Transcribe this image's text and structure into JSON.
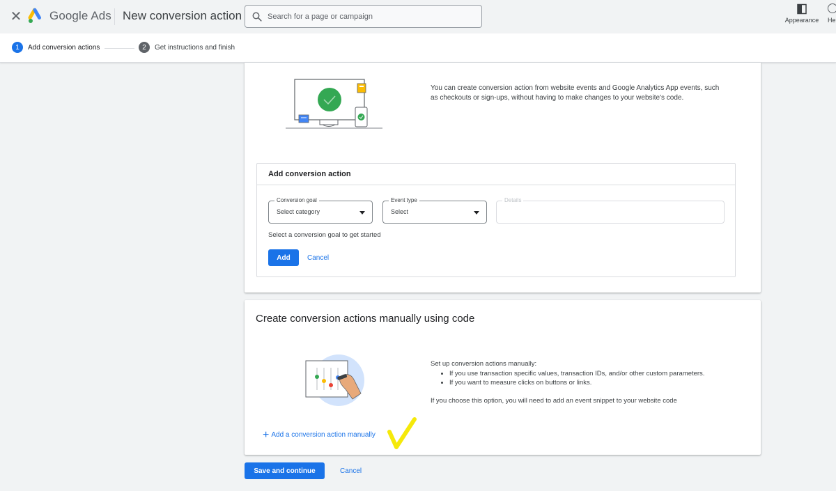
{
  "header": {
    "brand_google": "Google",
    "brand_ads": "Ads",
    "page_title": "New conversion action",
    "search_placeholder": "Search for a page or campaign",
    "appearance_label": "Appearance",
    "help_label": "He"
  },
  "stepper": {
    "steps": [
      {
        "number": "1",
        "label": "Add conversion actions"
      },
      {
        "number": "2",
        "label": "Get instructions and finish"
      }
    ]
  },
  "events_card": {
    "description": "You can create conversion action from website events and Google Analytics App events, such as checkouts or sign-ups, without having to make changes to your website's code.",
    "panel_title": "Add conversion action",
    "goal_label": "Conversion goal",
    "goal_value": "Select category",
    "event_label": "Event type",
    "event_value": "Select",
    "details_label": "Details",
    "hint": "Select a conversion goal to get started",
    "add_label": "Add",
    "cancel_label": "Cancel"
  },
  "manual_card": {
    "title": "Create conversion actions manually using code",
    "intro": "Set up conversion actions manually:",
    "bullets": [
      "If you use transaction specific values, transaction IDs, and/or other custom parameters.",
      "If you want to measure clicks on buttons or links."
    ],
    "note": "If you choose this option, you will need to add an event snippet to your website code",
    "add_manual_label": "Add a conversion action manually"
  },
  "footer": {
    "save_label": "Save and continue",
    "cancel_label": "Cancel"
  },
  "colors": {
    "primary": "#1a73e8",
    "annotation_tick": "#f5e90a"
  }
}
